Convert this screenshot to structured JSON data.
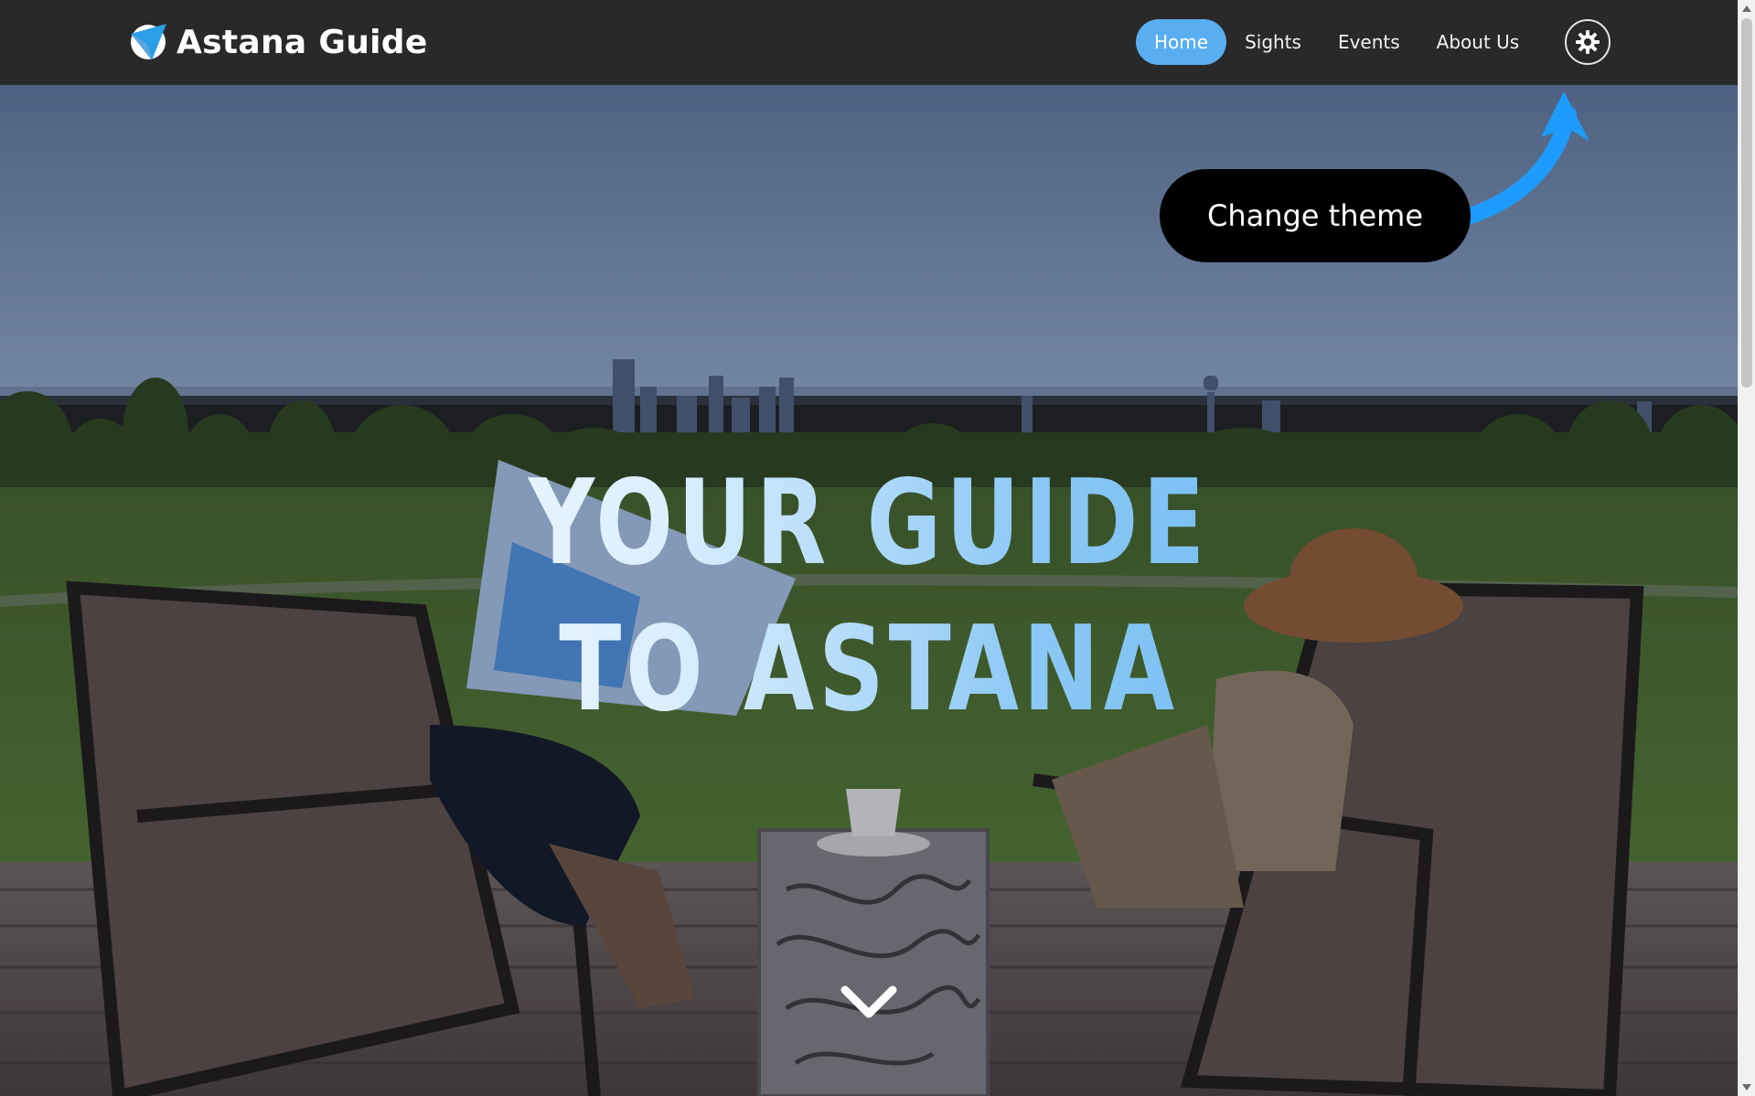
{
  "header": {
    "brand_name": "Astana Guide",
    "logo_icon": "paper-plane-icon",
    "nav": [
      {
        "label": "Home",
        "active": true
      },
      {
        "label": "Sights",
        "active": false
      },
      {
        "label": "Events",
        "active": false
      },
      {
        "label": "About Us",
        "active": false
      }
    ],
    "theme_button_icon": "sun-gear-icon"
  },
  "hero": {
    "title_line1": "YOUR GUIDE",
    "title_line2": "TO ASTANA",
    "scroll_icon": "chevron-down-icon"
  },
  "tooltip": {
    "text": "Change theme"
  },
  "colors": {
    "navbar_bg": "#292929",
    "accent": "#58aef0",
    "tooltip_bg": "#000000",
    "arrow": "#1e9bff"
  }
}
